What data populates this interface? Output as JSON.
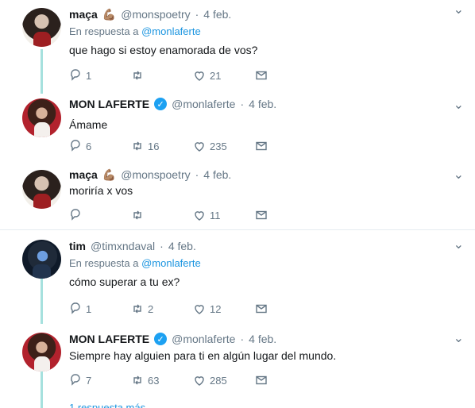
{
  "tweets": [
    {
      "name": "maça",
      "emoji": "💪🏽",
      "handle": "@monspoetry",
      "time": "4 feb.",
      "reply_prefix": "En respuesta a",
      "reply_mention": "@monlaferte",
      "text": "que hago si estoy enamorada de vos?",
      "replies": "1",
      "retweets": "",
      "likes": "21"
    },
    {
      "name": "MON LAFERTE",
      "verified": true,
      "handle": "@monlaferte",
      "time": "4 feb.",
      "text": "Ámame",
      "replies": "6",
      "retweets": "16",
      "likes": "235"
    },
    {
      "name": "maça",
      "emoji": "💪🏽",
      "handle": "@monspoetry",
      "time": "4 feb.",
      "text": "moriría x vos",
      "replies": "",
      "retweets": "",
      "likes": "11"
    },
    {
      "name": "tim",
      "handle": "@timxndaval",
      "time": "4 feb.",
      "reply_prefix": "En respuesta a",
      "reply_mention": "@monlaferte",
      "text": "cómo superar a tu ex?",
      "replies": "1",
      "retweets": "2",
      "likes": "12"
    },
    {
      "name": "MON LAFERTE",
      "verified": true,
      "handle": "@monlaferte",
      "time": "4 feb.",
      "text": "Siempre hay alguien para ti en algún lugar del mundo.",
      "replies": "7",
      "retweets": "63",
      "likes": "285"
    }
  ],
  "more_replies": "1 respuesta más",
  "icons": [
    "reply-icon",
    "retweet-icon",
    "like-icon",
    "dm-icon",
    "chevron-down-icon",
    "verified-icon"
  ],
  "colors": {
    "thread_line": "#a6e1de",
    "mention": "#1b95e0",
    "muted": "#657786",
    "verified": "#1da1f2"
  }
}
